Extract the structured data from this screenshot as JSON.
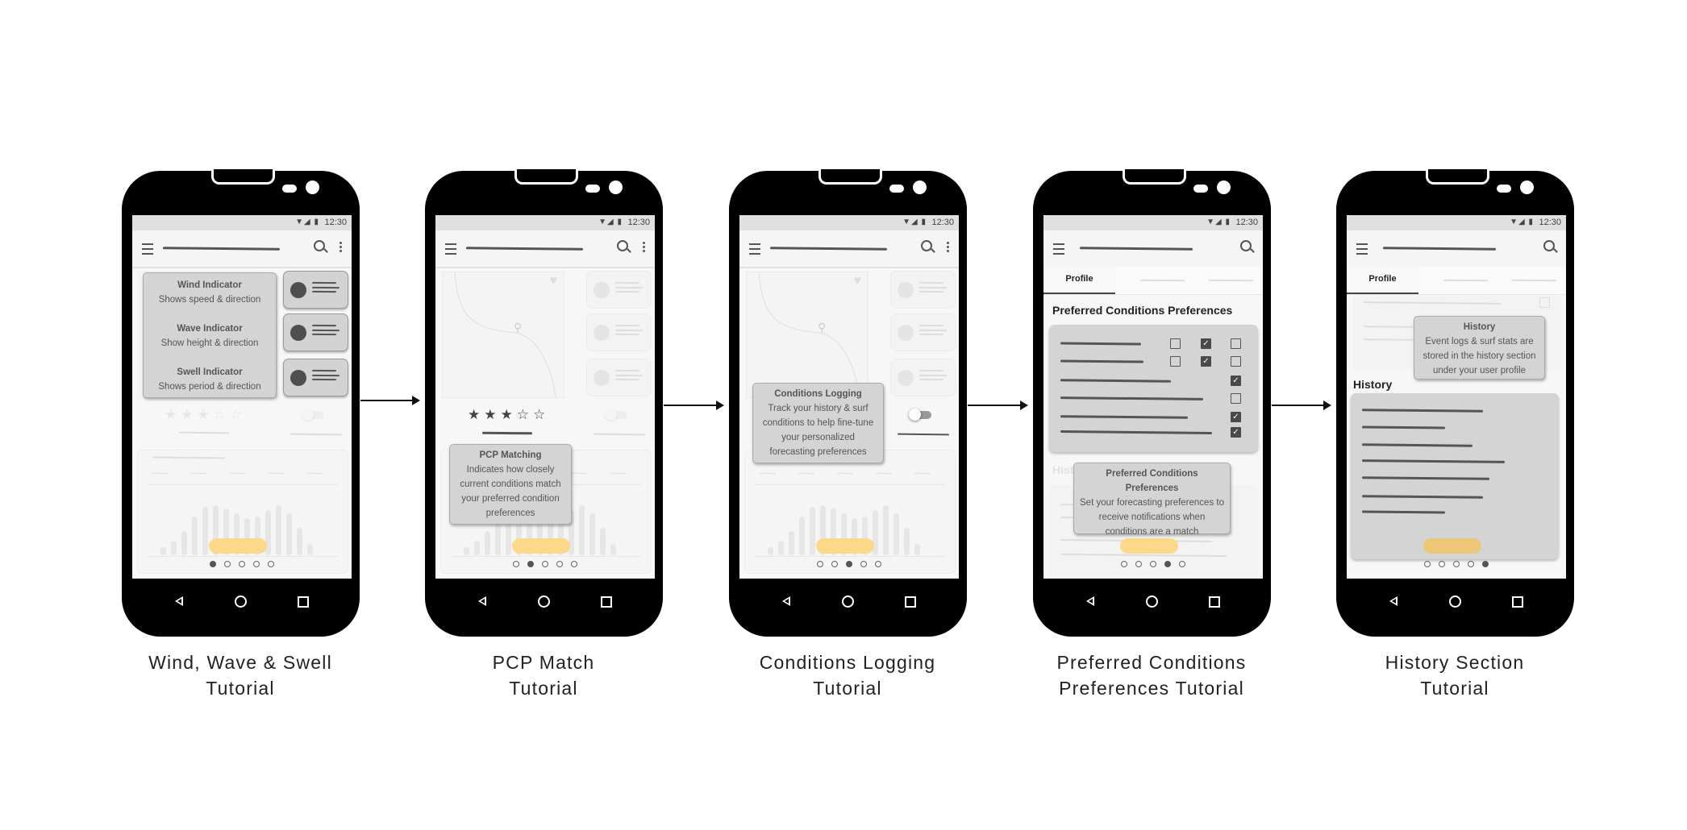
{
  "status_time": "12:30",
  "status_icons": "wifi-icon signal-icon battery-icon",
  "accent_color": "#fcd98a",
  "phones": [
    {
      "label_lines": [
        "Wind, Wave & Swell",
        "Tutorial"
      ],
      "active_dot": 0,
      "tooltips": [
        {
          "title": "Wind Indicator",
          "body": "Shows speed & direction"
        },
        {
          "title": "Wave Indicator",
          "body": "Show height & direction"
        },
        {
          "title": "Swell Indicator",
          "body": "Shows period & direction"
        }
      ],
      "rating": 3
    },
    {
      "label_lines": [
        "PCP Match",
        "Tutorial"
      ],
      "active_dot": 1,
      "tooltip": {
        "title": "PCP Matching",
        "body": "Indicates how closely current conditions match your preferred condition preferences"
      },
      "rating": 3
    },
    {
      "label_lines": [
        "Conditions Logging",
        "Tutorial"
      ],
      "active_dot": 2,
      "tooltip": {
        "title": "Conditions Logging",
        "body": "Track your history & surf conditions to help fine-tune your personalized forecasting preferences"
      },
      "rating": 3,
      "toggle_on": true
    },
    {
      "label_lines": [
        "Preferred Conditions",
        "Preferences Tutorial"
      ],
      "active_dot": 3,
      "tab": "Profile",
      "section_title": "Preferred Conditions Preferences",
      "faded_heading": "History",
      "checkbox_rows": [
        [
          false,
          true,
          false
        ],
        [
          false,
          true,
          false
        ],
        [
          null,
          null,
          true
        ],
        [
          null,
          null,
          false
        ],
        [
          null,
          null,
          true
        ],
        [
          null,
          null,
          true
        ]
      ],
      "tooltip": {
        "title": "Preferred Conditions Preferences",
        "body": "Set your forecasting preferences to receive notifications when conditions are a match"
      }
    },
    {
      "label_lines": [
        "History Section",
        "Tutorial"
      ],
      "active_dot": 4,
      "tab": "Profile",
      "section_title": "History",
      "tooltip": {
        "title": "History",
        "body": "Event logs & surf stats are stored in the history section under your user profile"
      }
    }
  ]
}
